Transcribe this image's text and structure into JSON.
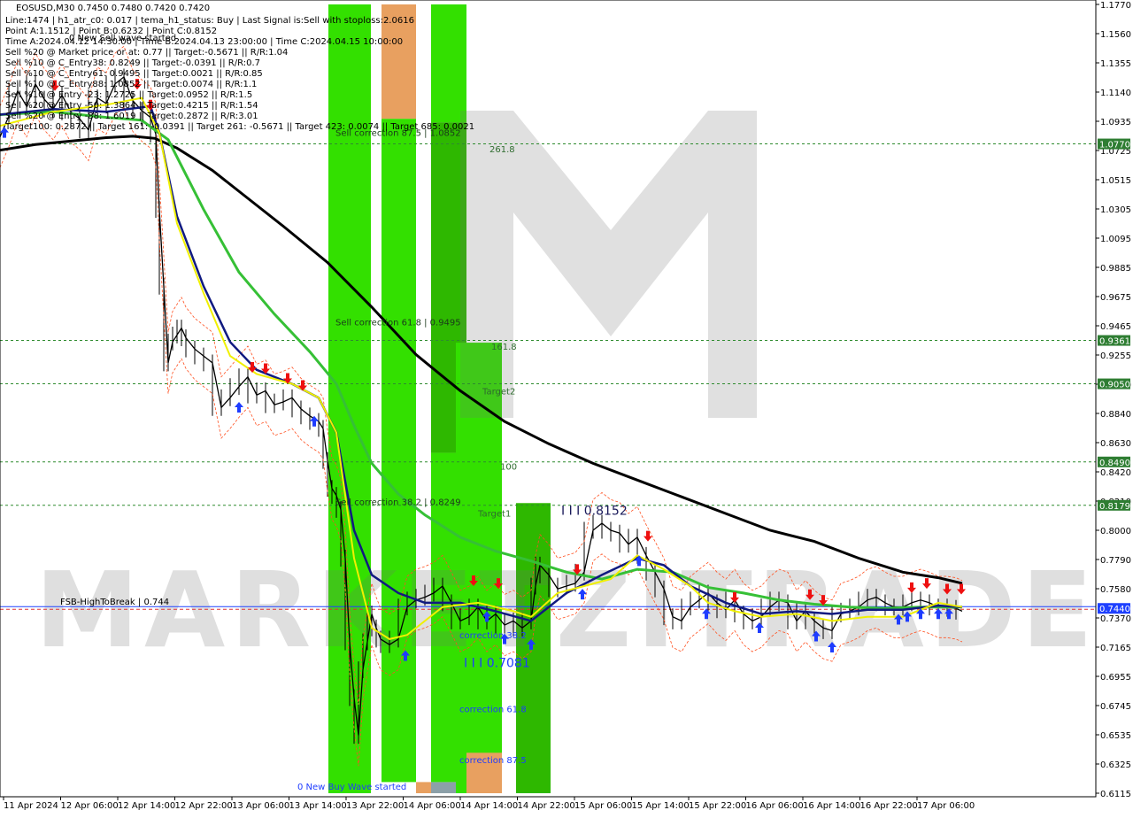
{
  "header": {
    "symbol_line": "EOSUSD,M30  0.7450 0.7480 0.7420 0.7420",
    "info_lines": [
      "Line:1474 | h1_atr_c0: 0.017 | tema_h1_status: Buy | Last Signal is:Sell with stoploss:2.0616",
      "Point A:1.1512 | Point B:0.6232 | Point C:0.8152",
      "Time A:2024.04.12 14:30:00 | Time B:2024.04.13 23:00:00 | Time C:2024.04.15 10:00:00",
      "Sell %20 @ Market price or at: 0.77 || Target:-0.5671 || R/R:1.04",
      "Sell %10 @ C_Entry38: 0.8249 || Target:-0.0391 || R/R:0.7",
      "Sell %10 @ C_Entry61: 0.9495 || Target:0.0021 || R/R:0.85",
      "Sell %10 @ C_Entry88: 1.0852 || Target:0.0074 || R/R:1.1",
      "Sell %10 @ Entry -23: 1.2725 || Target:0.0952 || R/R:1.5",
      "Sell %20 @ Entry -50: 1.3864 || Target:0.4215 || R/R:1.54",
      "Sell %20 @ Entry -88: 1.6019 || Target:0.2872 || R/R:3.01",
      "Target100: 0.2872 || Target 161: -0.0391 || Target 261: -0.5671 || Target 423: 0.0074 || Target 685: 0.0021"
    ],
    "wave_label": "0 New Sell wave started"
  },
  "chart_data": {
    "type": "candlestick",
    "symbol": "EOSUSD",
    "timeframe": "M30",
    "ylim": [
      0.6115,
      1.177
    ],
    "y_ticks": [
      "1.1770",
      "1.1560",
      "1.1355",
      "1.1140",
      "1.0935",
      "1.0725",
      "1.0515",
      "1.0305",
      "1.0095",
      "0.9885",
      "0.9675",
      "0.9465",
      "0.9255",
      "0.9050",
      "0.8840",
      "0.8630",
      "0.8420",
      "0.8210",
      "0.8000",
      "0.7790",
      "0.7580",
      "0.7370",
      "0.7165",
      "0.6955",
      "0.6745",
      "0.6535",
      "0.6325",
      "0.6115"
    ],
    "x_ticks": [
      "11 Apr 2024",
      "12 Apr 06:00",
      "12 Apr 14:00",
      "12 Apr 22:00",
      "13 Apr 06:00",
      "13 Apr 14:00",
      "13 Apr 22:00",
      "14 Apr 06:00",
      "14 Apr 14:00",
      "14 Apr 22:00",
      "15 Apr 06:00",
      "15 Apr 14:00",
      "15 Apr 22:00",
      "16 Apr 06:00",
      "16 Apr 14:00",
      "16 Apr 22:00",
      "17 Apr 06:00"
    ],
    "horizontal_levels": [
      {
        "price": 1.077,
        "label": "1.0770",
        "color": "#2e7d32"
      },
      {
        "price": 0.9361,
        "label": "0.9361",
        "color": "#2e7d32"
      },
      {
        "price": 0.905,
        "label": "0.9050",
        "color": "#2e7d32"
      },
      {
        "price": 0.849,
        "label": "0.8490",
        "color": "#2e7d32"
      },
      {
        "price": 0.8179,
        "label": "0.8179",
        "color": "#2e7d32"
      }
    ],
    "current_price": {
      "price": 0.744,
      "label": "0.7440",
      "color": "#1e40ff"
    },
    "fsb_line": {
      "price": 0.744,
      "label": "FSB-HighToBreak | 0.744"
    },
    "level_labels": [
      {
        "text": "Sell correction 87.5 | 1.0852",
        "price": 1.0852
      },
      {
        "text": "261.8",
        "price": 1.0735
      },
      {
        "text": "Sell correction 61.8 | 0.9495",
        "price": 0.9495
      },
      {
        "text": "161.8",
        "price": 0.932
      },
      {
        "text": "Target2",
        "price": 0.9
      },
      {
        "text": "100",
        "price": 0.846
      },
      {
        "text": "Sell correction 38.2 | 0.8249",
        "price": 0.8205
      },
      {
        "text": "Target1",
        "price": 0.8125
      },
      {
        "text": "I I I 0.8152",
        "price": 0.8135
      },
      {
        "text": "correction 38.2",
        "price": 0.725
      },
      {
        "text": "I I I 0.7081",
        "price": 0.7045
      },
      {
        "text": "correction 61.8",
        "price": 0.672
      },
      {
        "text": "correction 87.5",
        "price": 0.6355
      },
      {
        "text": "0 New Buy Wave started",
        "price": 0.6165
      }
    ],
    "close_path": [
      [
        0,
        1.082
      ],
      [
        10,
        1.097
      ],
      [
        20,
        1.115
      ],
      [
        30,
        1.104
      ],
      [
        40,
        1.12
      ],
      [
        50,
        1.109
      ],
      [
        60,
        1.102
      ],
      [
        70,
        1.112
      ],
      [
        80,
        1.1
      ],
      [
        90,
        1.095
      ],
      [
        100,
        1.087
      ],
      [
        110,
        1.11
      ],
      [
        120,
        1.106
      ],
      [
        130,
        1.12
      ],
      [
        140,
        1.125
      ],
      [
        150,
        1.108
      ],
      [
        160,
        1.101
      ],
      [
        170,
        1.096
      ],
      [
        176,
        1.084
      ],
      [
        180,
        1.03
      ],
      [
        185,
        0.975
      ],
      [
        190,
        0.92
      ],
      [
        195,
        0.935
      ],
      [
        200,
        0.94
      ],
      [
        205,
        0.945
      ],
      [
        210,
        0.938
      ],
      [
        220,
        0.93
      ],
      [
        230,
        0.925
      ],
      [
        240,
        0.92
      ],
      [
        250,
        0.888
      ],
      [
        260,
        0.895
      ],
      [
        270,
        0.903
      ],
      [
        280,
        0.91
      ],
      [
        290,
        0.897
      ],
      [
        300,
        0.9
      ],
      [
        310,
        0.89
      ],
      [
        320,
        0.892
      ],
      [
        330,
        0.895
      ],
      [
        340,
        0.887
      ],
      [
        350,
        0.882
      ],
      [
        360,
        0.878
      ],
      [
        365,
        0.873
      ],
      [
        370,
        0.85
      ],
      [
        375,
        0.83
      ],
      [
        380,
        0.825
      ],
      [
        385,
        0.815
      ],
      [
        390,
        0.78
      ],
      [
        395,
        0.72
      ],
      [
        400,
        0.68
      ],
      [
        405,
        0.653
      ],
      [
        410,
        0.7
      ],
      [
        415,
        0.72
      ],
      [
        420,
        0.74
      ],
      [
        425,
        0.73
      ],
      [
        430,
        0.722
      ],
      [
        440,
        0.718
      ],
      [
        450,
        0.722
      ],
      [
        460,
        0.745
      ],
      [
        470,
        0.75
      ],
      [
        480,
        0.752
      ],
      [
        490,
        0.755
      ],
      [
        500,
        0.76
      ],
      [
        510,
        0.748
      ],
      [
        520,
        0.735
      ],
      [
        530,
        0.738
      ],
      [
        540,
        0.745
      ],
      [
        550,
        0.735
      ],
      [
        560,
        0.74
      ],
      [
        570,
        0.732
      ],
      [
        580,
        0.735
      ],
      [
        590,
        0.73
      ],
      [
        600,
        0.735
      ],
      [
        605,
        0.76
      ],
      [
        610,
        0.775
      ],
      [
        620,
        0.768
      ],
      [
        630,
        0.758
      ],
      [
        640,
        0.76
      ],
      [
        650,
        0.762
      ],
      [
        660,
        0.77
      ],
      [
        670,
        0.8
      ],
      [
        680,
        0.805
      ],
      [
        690,
        0.8
      ],
      [
        700,
        0.798
      ],
      [
        710,
        0.79
      ],
      [
        720,
        0.795
      ],
      [
        730,
        0.782
      ],
      [
        740,
        0.77
      ],
      [
        750,
        0.758
      ],
      [
        760,
        0.738
      ],
      [
        770,
        0.735
      ],
      [
        780,
        0.745
      ],
      [
        790,
        0.75
      ],
      [
        800,
        0.755
      ],
      [
        810,
        0.748
      ],
      [
        820,
        0.743
      ],
      [
        830,
        0.75
      ],
      [
        840,
        0.74
      ],
      [
        850,
        0.735
      ],
      [
        860,
        0.738
      ],
      [
        870,
        0.745
      ],
      [
        880,
        0.75
      ],
      [
        890,
        0.748
      ],
      [
        900,
        0.735
      ],
      [
        910,
        0.742
      ],
      [
        920,
        0.735
      ],
      [
        930,
        0.73
      ],
      [
        940,
        0.728
      ],
      [
        950,
        0.74
      ],
      [
        960,
        0.742
      ],
      [
        970,
        0.745
      ],
      [
        980,
        0.75
      ],
      [
        990,
        0.752
      ],
      [
        1000,
        0.748
      ],
      [
        1010,
        0.745
      ],
      [
        1020,
        0.745
      ],
      [
        1030,
        0.748
      ],
      [
        1040,
        0.75
      ],
      [
        1050,
        0.748
      ],
      [
        1060,
        0.745
      ],
      [
        1070,
        0.745
      ],
      [
        1080,
        0.744
      ],
      [
        1087,
        0.742
      ]
    ],
    "ma_black": [
      [
        0,
        1.0725
      ],
      [
        40,
        1.0765
      ],
      [
        80,
        1.079
      ],
      [
        120,
        1.0815
      ],
      [
        150,
        1.0825
      ],
      [
        175,
        1.081
      ],
      [
        200,
        1.074
      ],
      [
        240,
        1.058
      ],
      [
        280,
        1.038
      ],
      [
        320,
        1.018
      ],
      [
        370,
        0.992
      ],
      [
        420,
        0.96
      ],
      [
        470,
        0.926
      ],
      [
        520,
        0.9
      ],
      [
        570,
        0.878
      ],
      [
        620,
        0.862
      ],
      [
        670,
        0.848
      ],
      [
        720,
        0.836
      ],
      [
        770,
        0.824
      ],
      [
        820,
        0.812
      ],
      [
        870,
        0.8
      ],
      [
        920,
        0.792
      ],
      [
        970,
        0.78
      ],
      [
        1020,
        0.77
      ],
      [
        1060,
        0.766
      ],
      [
        1087,
        0.762
      ]
    ],
    "ma_green": [
      [
        0,
        1.098
      ],
      [
        60,
        1.1
      ],
      [
        120,
        1.096
      ],
      [
        160,
        1.094
      ],
      [
        190,
        1.08
      ],
      [
        230,
        1.03
      ],
      [
        270,
        0.985
      ],
      [
        310,
        0.955
      ],
      [
        350,
        0.928
      ],
      [
        380,
        0.905
      ],
      [
        400,
        0.875
      ],
      [
        420,
        0.848
      ],
      [
        450,
        0.826
      ],
      [
        480,
        0.811
      ],
      [
        520,
        0.795
      ],
      [
        560,
        0.785
      ],
      [
        600,
        0.778
      ],
      [
        640,
        0.77
      ],
      [
        680,
        0.765
      ],
      [
        720,
        0.772
      ],
      [
        760,
        0.77
      ],
      [
        800,
        0.759
      ],
      [
        840,
        0.755
      ],
      [
        880,
        0.75
      ],
      [
        920,
        0.747
      ],
      [
        960,
        0.745
      ],
      [
        1000,
        0.744
      ],
      [
        1040,
        0.745
      ],
      [
        1087,
        0.745
      ]
    ],
    "ma_navy": [
      [
        0,
        1.098
      ],
      [
        60,
        1.102
      ],
      [
        120,
        1.1
      ],
      [
        170,
        1.104
      ],
      [
        180,
        1.085
      ],
      [
        200,
        1.025
      ],
      [
        230,
        0.975
      ],
      [
        260,
        0.935
      ],
      [
        290,
        0.915
      ],
      [
        330,
        0.905
      ],
      [
        360,
        0.895
      ],
      [
        380,
        0.87
      ],
      [
        400,
        0.8
      ],
      [
        420,
        0.768
      ],
      [
        450,
        0.755
      ],
      [
        480,
        0.748
      ],
      [
        520,
        0.748
      ],
      [
        560,
        0.742
      ],
      [
        600,
        0.735
      ],
      [
        640,
        0.755
      ],
      [
        680,
        0.768
      ],
      [
        720,
        0.78
      ],
      [
        750,
        0.775
      ],
      [
        780,
        0.76
      ],
      [
        820,
        0.748
      ],
      [
        860,
        0.74
      ],
      [
        900,
        0.742
      ],
      [
        940,
        0.74
      ],
      [
        980,
        0.743
      ],
      [
        1020,
        0.743
      ],
      [
        1060,
        0.746
      ],
      [
        1087,
        0.745
      ]
    ],
    "ma_yellow": [
      [
        0,
        1.09
      ],
      [
        60,
        1.1
      ],
      [
        120,
        1.105
      ],
      [
        160,
        1.11
      ],
      [
        180,
        1.085
      ],
      [
        200,
        1.02
      ],
      [
        230,
        0.97
      ],
      [
        260,
        0.925
      ],
      [
        290,
        0.912
      ],
      [
        330,
        0.905
      ],
      [
        360,
        0.895
      ],
      [
        380,
        0.87
      ],
      [
        400,
        0.78
      ],
      [
        420,
        0.73
      ],
      [
        440,
        0.722
      ],
      [
        460,
        0.725
      ],
      [
        480,
        0.735
      ],
      [
        500,
        0.745
      ],
      [
        540,
        0.748
      ],
      [
        580,
        0.742
      ],
      [
        600,
        0.738
      ],
      [
        630,
        0.755
      ],
      [
        660,
        0.76
      ],
      [
        690,
        0.765
      ],
      [
        720,
        0.782
      ],
      [
        750,
        0.772
      ],
      [
        780,
        0.76
      ],
      [
        800,
        0.748
      ],
      [
        830,
        0.742
      ],
      [
        860,
        0.738
      ],
      [
        900,
        0.74
      ],
      [
        940,
        0.735
      ],
      [
        980,
        0.738
      ],
      [
        1020,
        0.738
      ],
      [
        1060,
        0.748
      ],
      [
        1087,
        0.745
      ]
    ],
    "buy_arrows": [
      [
        5,
        1.089
      ],
      [
        270,
        0.892
      ],
      [
        355,
        0.882
      ],
      [
        458,
        0.714
      ],
      [
        550,
        0.742
      ],
      [
        570,
        0.726
      ],
      [
        600,
        0.722
      ],
      [
        658,
        0.758
      ],
      [
        722,
        0.782
      ],
      [
        798,
        0.744
      ],
      [
        858,
        0.734
      ],
      [
        922,
        0.728
      ],
      [
        940,
        0.72
      ],
      [
        1015,
        0.74
      ],
      [
        1025,
        0.742
      ],
      [
        1040,
        0.744
      ],
      [
        1060,
        0.744
      ],
      [
        1072,
        0.744
      ]
    ],
    "sell_arrows": [
      [
        62,
        1.115
      ],
      [
        155,
        1.116
      ],
      [
        170,
        1.101
      ],
      [
        285,
        0.913
      ],
      [
        300,
        0.912
      ],
      [
        325,
        0.905
      ],
      [
        342,
        0.9
      ],
      [
        535,
        0.76
      ],
      [
        563,
        0.758
      ],
      [
        652,
        0.768
      ],
      [
        732,
        0.792
      ],
      [
        830,
        0.748
      ],
      [
        915,
        0.75
      ],
      [
        930,
        0.746
      ],
      [
        1030,
        0.755
      ],
      [
        1047,
        0.758
      ],
      [
        1070,
        0.754
      ],
      [
        1086,
        0.754
      ]
    ],
    "zone_rects": [
      {
        "x1": 371,
        "x2": 419,
        "top": 1.177,
        "bottom": 0.6115,
        "color": "#33e000"
      },
      {
        "x1": 431,
        "x2": 470,
        "top": 1.177,
        "bottom": 1.095,
        "color": "#e8a060"
      },
      {
        "x1": 431,
        "x2": 470,
        "top": 1.095,
        "bottom": 0.6195,
        "color": "#33e000"
      },
      {
        "x1": 470,
        "x2": 487,
        "top": 0.6195,
        "bottom": 0.6115,
        "color": "#e8a060"
      },
      {
        "x1": 487,
        "x2": 515,
        "top": 0.6195,
        "bottom": 0.6115,
        "color": "#8ca0a8"
      },
      {
        "x1": 487,
        "x2": 527,
        "top": 1.177,
        "bottom": 1.0925,
        "color": "#33e000"
      },
      {
        "x1": 487,
        "x2": 527,
        "top": 1.0925,
        "bottom": 0.8555,
        "color": "#2eb800"
      },
      {
        "x1": 487,
        "x2": 515,
        "top": 0.8555,
        "bottom": 0.6195,
        "color": "#33e000"
      },
      {
        "x1": 515,
        "x2": 567,
        "top": 0.9345,
        "bottom": 0.6115,
        "color": "#33e000"
      },
      {
        "x1": 527,
        "x2": 567,
        "top": 0.6405,
        "bottom": 0.6115,
        "color": "#e8a060"
      },
      {
        "x1": 583,
        "x2": 622,
        "top": 0.8195,
        "bottom": 0.6115,
        "color": "#2eb800"
      }
    ],
    "grid": false,
    "legend": "none"
  }
}
